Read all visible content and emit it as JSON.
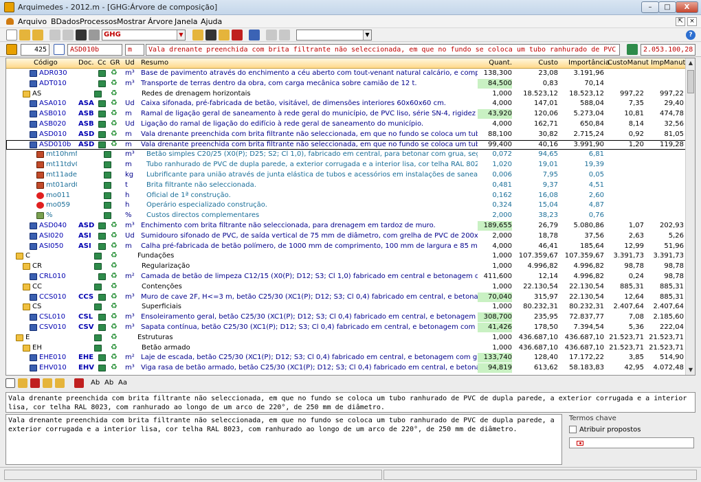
{
  "window": {
    "title": "Arquimedes - 2012.m - [GHG:Árvore de composição]",
    "min": "–",
    "max": "□",
    "close": "X"
  },
  "menu": [
    "Arquivo",
    "BDados",
    "Processos",
    "Mostrar",
    "Árvore",
    "Janela",
    "Ajuda"
  ],
  "mdi": {
    "restore": "⇱",
    "close": "×"
  },
  "toolbar": {
    "ghg_combo": "GHG",
    "empty_combo": "",
    "help": "?"
  },
  "infobar": {
    "quantity": "425",
    "code": "ASD010b",
    "unit": "m",
    "summary": "Vala drenante preenchida com brita filtrante não seleccionada, em que no fundo se coloca um tubo ranhurado de PVC de dup",
    "total": "2.053.100,28"
  },
  "columns": [
    "Código",
    "Doc.",
    "Cc",
    "GR",
    "Ud",
    "Resumo",
    "Quant.",
    "Custo",
    "Importância",
    "CustoManut",
    "ImpManut"
  ],
  "rows": [
    {
      "level": 2,
      "icon": "book",
      "code": "ADR030",
      "doc": "",
      "ud": "m³",
      "resumo": "Base de pavimento através do enchimento a céu aberto com tout-venant natural calcário, e compactação a 95",
      "quant": "138,300",
      "custo": "23,08",
      "imp": "3.191,96",
      "cman": "",
      "iman": "",
      "kind": "item",
      "hl": false
    },
    {
      "level": 2,
      "icon": "book",
      "code": "ADT010",
      "doc": "",
      "ud": "m³",
      "resumo": "Transporte de terras dentro da obra, com carga mecânica sobre camião de 12 t.",
      "quant": "84,500",
      "custo": "0,83",
      "imp": "70,14",
      "cman": "",
      "iman": "",
      "kind": "item",
      "hl": true
    },
    {
      "level": 1,
      "icon": "folder",
      "code": "AS",
      "doc": "",
      "ud": "",
      "resumo": "Redes de drenagem horizontais",
      "quant": "1,000",
      "custo": "18.523,12",
      "imp": "18.523,12",
      "cman": "997,22",
      "iman": "997,22",
      "kind": "chapter",
      "hl": false
    },
    {
      "level": 2,
      "icon": "book",
      "code": "ASA010",
      "doc": "ASA",
      "ud": "Ud",
      "resumo": "Caixa sifonada, pré-fabricada de betão, visitável, de dimensões interiores 60x60x60 cm.",
      "quant": "4,000",
      "custo": "147,01",
      "imp": "588,04",
      "cman": "7,35",
      "iman": "29,40",
      "kind": "item",
      "hl": false
    },
    {
      "level": 2,
      "icon": "book",
      "code": "ASB010",
      "doc": "ASB",
      "ud": "m",
      "resumo": "Ramal de ligação geral de saneamento à rede geral do município, de PVC liso, série SN-4, rigidez anular nor",
      "quant": "43,920",
      "custo": "120,06",
      "imp": "5.273,04",
      "cman": "10,81",
      "iman": "474,78",
      "kind": "item",
      "hl": true
    },
    {
      "level": 2,
      "icon": "book",
      "code": "ASB020",
      "doc": "ASB",
      "ud": "Ud",
      "resumo": "Ligação do ramal de ligação do edifício à rede geral de saneamento do município.",
      "quant": "4,000",
      "custo": "162,71",
      "imp": "650,84",
      "cman": "8,14",
      "iman": "32,56",
      "kind": "item",
      "hl": false
    },
    {
      "level": 2,
      "icon": "book",
      "code": "ASD010",
      "doc": "ASD",
      "ud": "m",
      "resumo": "Vala drenante preenchida com brita filtrante não seleccionada, em que no fundo se coloca um tubo ranhurad",
      "quant": "88,100",
      "custo": "30,82",
      "imp": "2.715,24",
      "cman": "0,92",
      "iman": "81,05",
      "kind": "item",
      "hl": false
    },
    {
      "level": 2,
      "icon": "book",
      "code": "ASD010b",
      "doc": "ASD",
      "ud": "m",
      "resumo": "Vala drenante preenchida com brita filtrante não seleccionada, em que no fundo se coloca um tubo ranhurad",
      "quant": "99,400",
      "custo": "40,16",
      "imp": "3.991,90",
      "cman": "1,20",
      "iman": "119,28",
      "kind": "selected",
      "hl": false
    },
    {
      "level": 3,
      "icon": "brick",
      "code": "mt10hmf02…",
      "doc": "",
      "ud": "m³",
      "resumo": "Betão simples C20/25 (X0(P); D25; S2; Cl 1,0), fabricado em central, para betonar com grua, segundo NP E",
      "quant": "0,072",
      "custo": "94,65",
      "imp": "6,81",
      "cman": "",
      "iman": "",
      "kind": "sub",
      "hl": false
    },
    {
      "level": 3,
      "icon": "brick",
      "code": "mt11tdv01…",
      "doc": "",
      "ud": "m",
      "resumo": "Tubo ranhurado de PVC de dupla parede, a exterior corrugada e a interior lisa, cor telha RAL 8023, com ranl",
      "quant": "1,020",
      "custo": "19,01",
      "imp": "19,39",
      "cman": "",
      "iman": "",
      "kind": "sub",
      "hl": false
    },
    {
      "level": 3,
      "icon": "brick",
      "code": "mt11ade10…",
      "doc": "",
      "ud": "kg",
      "resumo": "Lubrificante para união através de junta elástica de tubos e acessórios em instalações de saneamento e d",
      "quant": "0,006",
      "custo": "7,95",
      "imp": "0,05",
      "cman": "",
      "iman": "",
      "kind": "sub",
      "hl": false
    },
    {
      "level": 3,
      "icon": "brick",
      "code": "mt01ard03…",
      "doc": "",
      "ud": "t",
      "resumo": "Brita filtrante não seleccionada.",
      "quant": "0,481",
      "custo": "9,37",
      "imp": "4,51",
      "cman": "",
      "iman": "",
      "kind": "sub",
      "hl": false
    },
    {
      "level": 3,
      "icon": "worker",
      "code": "mo011",
      "doc": "",
      "ud": "h",
      "resumo": "Oficial de 1ª construção.",
      "quant": "0,162",
      "custo": "16,08",
      "imp": "2,60",
      "cman": "",
      "iman": "",
      "kind": "sub",
      "hl": false
    },
    {
      "level": 3,
      "icon": "worker",
      "code": "mo059",
      "doc": "",
      "ud": "h",
      "resumo": "Operário especializado construção.",
      "quant": "0,324",
      "custo": "15,04",
      "imp": "4,87",
      "cman": "",
      "iman": "",
      "kind": "sub",
      "hl": false
    },
    {
      "level": 3,
      "icon": "pct",
      "code": "%",
      "doc": "",
      "ud": "%",
      "resumo": "Custos directos complementares",
      "quant": "2,000",
      "custo": "38,23",
      "imp": "0,76",
      "cman": "",
      "iman": "",
      "kind": "sub",
      "hl": false
    },
    {
      "level": 2,
      "icon": "book",
      "code": "ASD040",
      "doc": "ASD",
      "ud": "m³",
      "resumo": "Enchimento com brita filtrante não seleccionada, para drenagem em tardoz de muro.",
      "quant": "189,655",
      "custo": "26,79",
      "imp": "5.080,86",
      "cman": "1,07",
      "iman": "202,93",
      "kind": "item",
      "hl": true
    },
    {
      "level": 2,
      "icon": "book",
      "code": "ASI020",
      "doc": "ASI",
      "ud": "Ud",
      "resumo": "Sumidouro sifonado de PVC, de saída vertical de 75 mm de diâmetro, com grelha de PVC de 200x200 mm.",
      "quant": "2,000",
      "custo": "18,78",
      "imp": "37,56",
      "cman": "2,63",
      "iman": "5,26",
      "kind": "item",
      "hl": false
    },
    {
      "level": 2,
      "icon": "book",
      "code": "ASI050",
      "doc": "ASI",
      "ud": "m",
      "resumo": "Calha pré-fabricada de betão polímero, de 1000 mm de comprimento, 100 mm de largura e 85 mm de altura",
      "quant": "4,000",
      "custo": "46,41",
      "imp": "185,64",
      "cman": "12,99",
      "iman": "51,96",
      "kind": "item",
      "hl": false
    },
    {
      "level": 0,
      "icon": "folder",
      "code": "C",
      "doc": "",
      "ud": "",
      "resumo": "Fundações",
      "quant": "1,000",
      "custo": "107.359,67",
      "imp": "107.359,67",
      "cman": "3.391,73",
      "iman": "3.391,73",
      "kind": "chapter",
      "hl": false
    },
    {
      "level": 1,
      "icon": "folder",
      "code": "CR",
      "doc": "",
      "ud": "",
      "resumo": "Regularização",
      "quant": "1,000",
      "custo": "4.996,82",
      "imp": "4.996,82",
      "cman": "98,78",
      "iman": "98,78",
      "kind": "chapter",
      "hl": false
    },
    {
      "level": 2,
      "icon": "book",
      "code": "CRL010",
      "doc": "",
      "ud": "m²",
      "resumo": "Camada de betão de limpeza C12/15 (X0(P); D12; S3; Cl 1,0) fabricado em central e betonagem com grua, de",
      "quant": "411,600",
      "custo": "12,14",
      "imp": "4.996,82",
      "cman": "0,24",
      "iman": "98,78",
      "kind": "item",
      "hl": false
    },
    {
      "level": 1,
      "icon": "folder",
      "code": "CC",
      "doc": "",
      "ud": "",
      "resumo": "Contenções",
      "quant": "1,000",
      "custo": "22.130,54",
      "imp": "22.130,54",
      "cman": "885,31",
      "iman": "885,31",
      "kind": "chapter",
      "hl": false
    },
    {
      "level": 2,
      "icon": "book",
      "code": "CCS010",
      "doc": "CCS",
      "ud": "m³",
      "resumo": "Muro de cave 2F, H<=3 m, betão C25/30 (XC1(P); D12; S3; Cl 0,4) fabricado em central, e betonagem com gru",
      "quant": "70,040",
      "custo": "315,97",
      "imp": "22.130,54",
      "cman": "12,64",
      "iman": "885,31",
      "kind": "item",
      "hl": true
    },
    {
      "level": 1,
      "icon": "folder",
      "code": "CS",
      "doc": "",
      "ud": "",
      "resumo": "Superficiais",
      "quant": "1,000",
      "custo": "80.232,31",
      "imp": "80.232,31",
      "cman": "2.407,64",
      "iman": "2.407,64",
      "kind": "chapter",
      "hl": false
    },
    {
      "level": 2,
      "icon": "book",
      "code": "CSL010",
      "doc": "CSL",
      "ud": "m³",
      "resumo": "Ensoleiramento geral, betão C25/30 (XC1(P); D12; S3; Cl 0,4) fabricado em central, e betonagem com grua, a",
      "quant": "308,700",
      "custo": "235,95",
      "imp": "72.837,77",
      "cman": "7,08",
      "iman": "2.185,60",
      "kind": "item",
      "hl": true
    },
    {
      "level": 2,
      "icon": "book",
      "code": "CSV010",
      "doc": "CSV",
      "ud": "m³",
      "resumo": "Sapata contínua, betão C25/30 (XC1(P); D12; S3; Cl 0,4) fabricado em central, e betonagem com grua, aço A4",
      "quant": "41,426",
      "custo": "178,50",
      "imp": "7.394,54",
      "cman": "5,36",
      "iman": "222,04",
      "kind": "item",
      "hl": true
    },
    {
      "level": 0,
      "icon": "folder",
      "code": "E",
      "doc": "",
      "ud": "",
      "resumo": "Estruturas",
      "quant": "1,000",
      "custo": "436.687,10",
      "imp": "436.687,10",
      "cman": "21.523,71",
      "iman": "21.523,71",
      "kind": "chapter",
      "hl": false
    },
    {
      "level": 1,
      "icon": "folder",
      "code": "EH",
      "doc": "",
      "ud": "",
      "resumo": "Betão armado",
      "quant": "1,000",
      "custo": "436.687,10",
      "imp": "436.687,10",
      "cman": "21.523,71",
      "iman": "21.523,71",
      "kind": "chapter",
      "hl": false
    },
    {
      "level": 2,
      "icon": "book",
      "code": "EHE010",
      "doc": "EHE",
      "ud": "m²",
      "resumo": "Laje de escada, betão C25/30 (XC1(P); D12; S3; Cl 0,4) fabricado em central, e betonagem com grua, aço A4",
      "quant": "133,740",
      "custo": "128,40",
      "imp": "17.172,22",
      "cman": "3,85",
      "iman": "514,90",
      "kind": "item",
      "hl": true
    },
    {
      "level": 2,
      "icon": "book",
      "code": "EHV010",
      "doc": "EHV",
      "ud": "m³",
      "resumo": "Viga rasa de betão armado, betão C25/30 (XC1(P); D12; S3; Cl 0,4) fabricado em central, e betonagem com g",
      "quant": "94,819",
      "custo": "613,62",
      "imp": "58.183,83",
      "cman": "42,95",
      "iman": "4.072,48",
      "kind": "item",
      "hl": true
    }
  ],
  "bottom": {
    "text_short": "Vala drenante preenchida com brita filtrante não seleccionada, em que no fundo se coloca um tubo ranhurado de PVC de dupla parede, a exterior corrugada e a interior lisa, cor telha RAL 8023, com ranhurado ao longo de um arco de 220°, de 250 mm de diâmetro.",
    "text_long": "Vala drenante preenchida com brita filtrante não seleccionada, em que no fundo se coloca um tubo ranhurado de PVC de dupla parede, a exterior corrugada e a interior lisa, cor telha RAL 8023, com ranhurado ao longo de um arco de 220°, de 250 mm de diâmetro.",
    "keywords_title": "Termos chave",
    "keywords_check": "Atribuir propostos",
    "icons": [
      "Ab",
      "Ab",
      "Aa"
    ]
  }
}
